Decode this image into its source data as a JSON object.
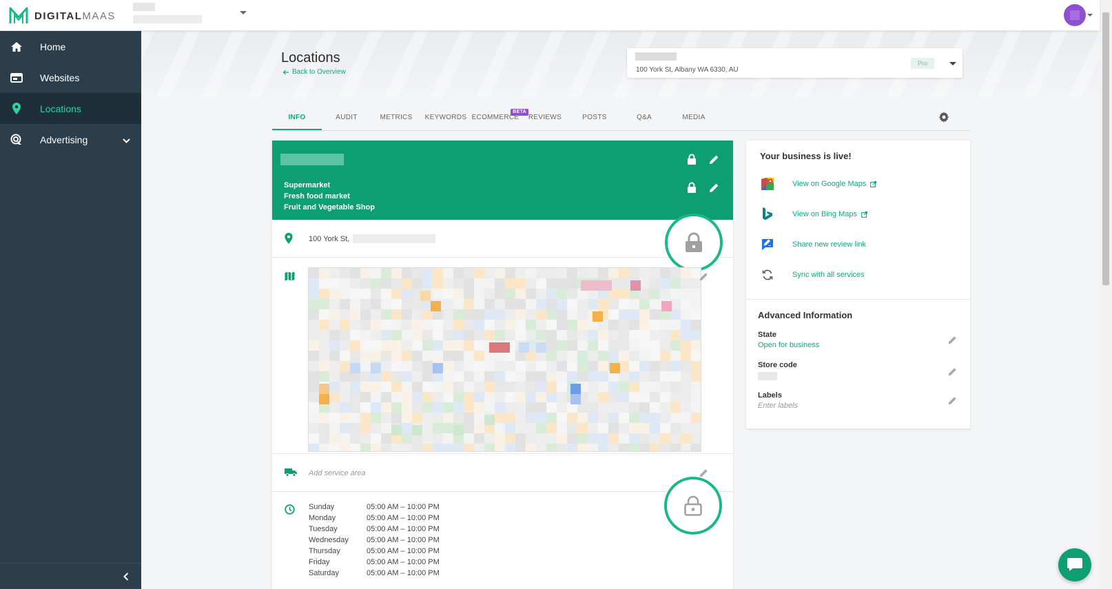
{
  "brand": {
    "name_bold": "DIGITAL",
    "name_light": "MAAS"
  },
  "sidebar": {
    "items": [
      {
        "label": "Home",
        "icon": "home-icon"
      },
      {
        "label": "Websites",
        "icon": "websites-icon"
      },
      {
        "label": "Locations",
        "icon": "location-pin-icon"
      },
      {
        "label": "Advertising",
        "icon": "advertising-icon"
      }
    ],
    "active": "Locations"
  },
  "header": {
    "title": "Locations",
    "back_link": "Back to Overview",
    "location_address": "100 York St, Albany WA 6330, AU",
    "plan_badge": "Pro"
  },
  "tabs": [
    {
      "label": "INFO"
    },
    {
      "label": "AUDIT"
    },
    {
      "label": "METRICS"
    },
    {
      "label": "KEYWORDS"
    },
    {
      "label": "ECOMMERCE",
      "badge": "BETA"
    },
    {
      "label": "REVIEWS"
    },
    {
      "label": "POSTS"
    },
    {
      "label": "Q&A"
    },
    {
      "label": "MEDIA"
    }
  ],
  "business": {
    "categories": [
      "Supermarket",
      "Fresh food market",
      "Fruit and Vegetable Shop"
    ],
    "address_partial": "100 York St,",
    "service_area_placeholder": "Add service area",
    "hours": [
      {
        "day": "Sunday",
        "time": "05:00 AM – 10:00 PM"
      },
      {
        "day": "Monday",
        "time": "05:00 AM – 10:00 PM"
      },
      {
        "day": "Tuesday",
        "time": "05:00 AM – 10:00 PM"
      },
      {
        "day": "Wednesday",
        "time": "05:00 AM – 10:00 PM"
      },
      {
        "day": "Thursday",
        "time": "05:00 AM – 10:00 PM"
      },
      {
        "day": "Friday",
        "time": "05:00 AM – 10:00 PM"
      },
      {
        "day": "Saturday",
        "time": "05:00 AM – 10:00 PM"
      }
    ]
  },
  "live_panel": {
    "title": "Your business is live!",
    "links": [
      {
        "label": "View on Google Maps",
        "icon": "google-maps-icon"
      },
      {
        "label": "View on Bing Maps",
        "icon": "bing-icon"
      },
      {
        "label": "Share new review link",
        "icon": "review-link-icon"
      },
      {
        "label": "Sync with all services",
        "icon": "sync-icon"
      }
    ]
  },
  "advanced": {
    "title": "Advanced Information",
    "state_label": "State",
    "state_value": "Open for business",
    "store_code_label": "Store code",
    "labels_label": "Labels",
    "labels_placeholder": "Enter labels"
  },
  "colors": {
    "brand_green": "#0d9e72",
    "accent_green": "#11a683",
    "sidebar": "#2c3e4c",
    "beta_purple": "#8e4fd0"
  }
}
